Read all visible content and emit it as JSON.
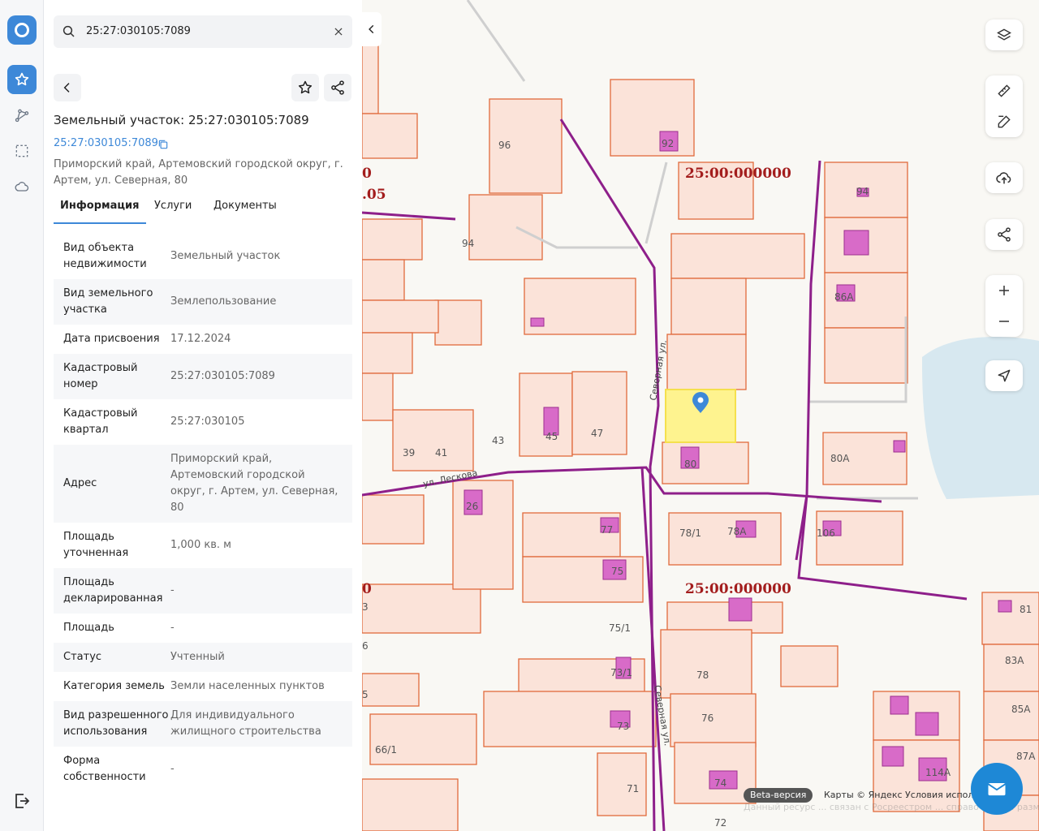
{
  "search": {
    "query": "25:27:030105:7089"
  },
  "panel": {
    "title": "Земельный участок: 25:27:030105:7089",
    "cadastral_link": "25:27:030105:7089",
    "address": "Приморский край, Артемовский городской округ, г. Артем, ул. Северная, 80",
    "tabs": [
      {
        "label": "Информация"
      },
      {
        "label": "Услуги"
      },
      {
        "label": "Документы"
      }
    ],
    "rows": [
      {
        "key": "Вид объекта недвижимости",
        "value": "Земельный участок"
      },
      {
        "key": "Вид земельного участка",
        "value": "Землепользование"
      },
      {
        "key": "Дата присвоения",
        "value": "17.12.2024"
      },
      {
        "key": "Кадастровый номер",
        "value": "25:27:030105:7089"
      },
      {
        "key": "Кадастровый квартал",
        "value": "25:27:030105"
      },
      {
        "key": "Адрес",
        "value": "Приморский край, Артемовский городской округ, г. Артем, ул. Северная, 80"
      },
      {
        "key": "Площадь уточненная",
        "value": "1,000 кв. м"
      },
      {
        "key": "Площадь декларированная",
        "value": "-"
      },
      {
        "key": "Площадь",
        "value": "-"
      },
      {
        "key": "Статус",
        "value": "Учтенный"
      },
      {
        "key": "Категория земель",
        "value": "Земли населенных пунктов"
      },
      {
        "key": "Вид разрешенного использования",
        "value": "Для индивидуального жилищного строительства"
      },
      {
        "key": "Форма собственности",
        "value": "-"
      }
    ]
  },
  "map": {
    "quarter_labels": [
      "25:00:000000",
      "25:00:000000",
      "0",
      ".05",
      "0"
    ],
    "street_labels": [
      "Северная ул.",
      "ул. Лескова",
      "Северная ул."
    ],
    "house_numbers": [
      "96",
      "92",
      "94",
      "94",
      "86А",
      "43",
      "45",
      "47",
      "39",
      "41",
      "80",
      "80А",
      "26",
      "77",
      "78/1",
      "78А",
      "106",
      "75",
      "75/1",
      "81",
      "83А",
      "85А",
      "87А",
      "114А",
      "73/1",
      "78",
      "76",
      "73",
      "71",
      "74",
      "72",
      "66/1",
      "3",
      "6",
      "5"
    ],
    "beta_label": "Beta-версия",
    "attribution": "Карты © Яндекс   Условия испол",
    "disclaimer": "Данный ресурс ... связан с Росреестром ... справочный ... размещенными ... Росреестр"
  },
  "colors": {
    "accent": "#3d88d8",
    "parcel_fill": "#fbe3d9",
    "parcel_stroke": "#e06a3c",
    "building": "#d86bc8",
    "boundary": "#8e1f8a",
    "selected": "#fff176",
    "water": "#d7e8f0"
  }
}
